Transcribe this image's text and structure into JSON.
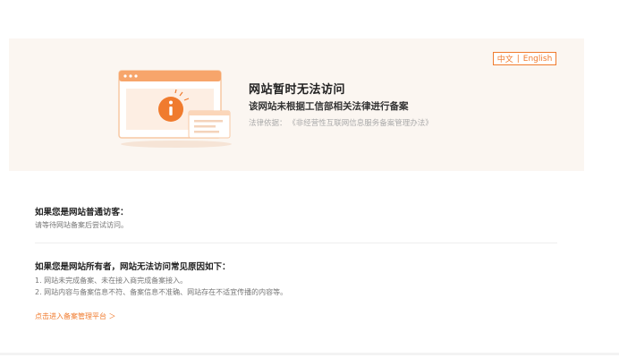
{
  "lang_switch": {
    "chinese": "中文",
    "separator": "|",
    "english": "English"
  },
  "banner": {
    "title": "网站暂时无法访问",
    "subtitle": "该网站未根据工信部相关法律进行备案",
    "law_label": "法律依据：",
    "law_name": "《非经营性互联网信息服务备案管理办法》"
  },
  "visitor": {
    "heading": "如果您是网站普通访客：",
    "text": "请等待网站备案后尝试访问。"
  },
  "owner": {
    "heading": "如果您是网站所有者，网站无法访问常见原因如下：",
    "reasons": [
      "1. 网站未完成备案、未在接入商完成备案接入。",
      "2. 网站内容与备案信息不符、备案信息不准确、网站存在不适宜传播的内容等。"
    ]
  },
  "portal_link": "点击进入备案管理平台 ＞",
  "colors": {
    "accent": "#f07b2e",
    "banner_bg": "#fbf6f1"
  },
  "icons": [
    "browser-window-icon",
    "info-icon"
  ]
}
